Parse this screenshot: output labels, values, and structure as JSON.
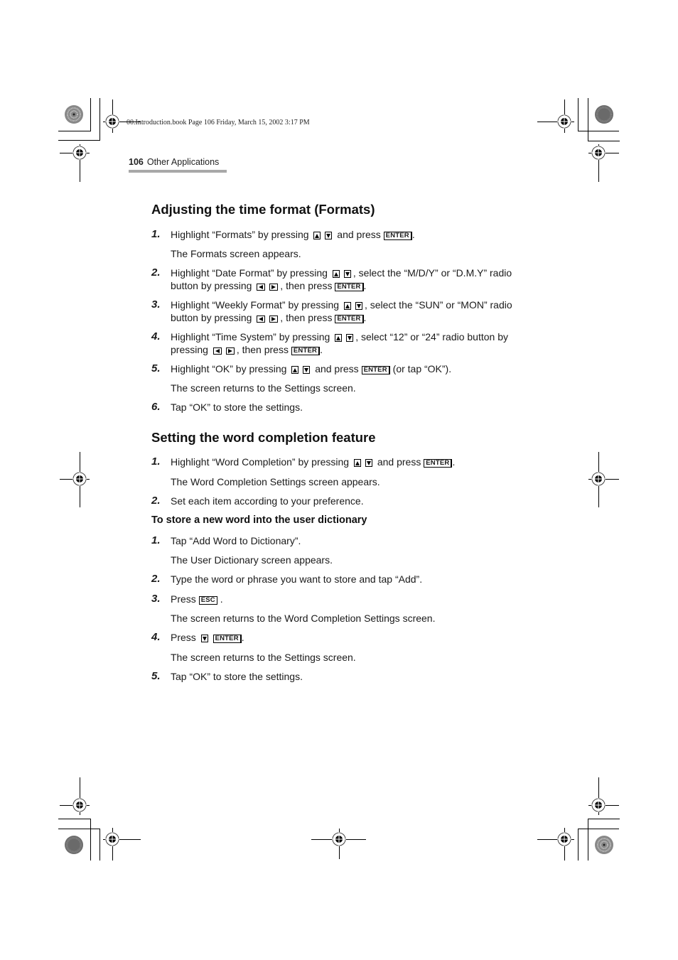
{
  "slug": "00.Introduction.book  Page 106  Friday, March 15, 2002  3:17 PM",
  "running_head": {
    "page_number": "106",
    "section": "Other Applications"
  },
  "sections": [
    {
      "title": "Adjusting the time format (Formats)",
      "steps": [
        {
          "n": "1.",
          "parts": [
            "Highlight “Formats” by pressing",
            "and press",
            "."
          ],
          "note": "The Formats screen appears."
        },
        {
          "n": "2.",
          "parts": [
            "Highlight “Date Format” by pressing",
            ", select the “M/D/Y” or “D.M.Y” radio button by pressing",
            ", then press",
            "."
          ]
        },
        {
          "n": "3.",
          "parts": [
            "Highlight “Weekly Format” by pressing",
            ", select the “SUN” or “MON” radio button by pressing",
            ", then press",
            "."
          ]
        },
        {
          "n": "4.",
          "parts": [
            "Highlight “Time System” by pressing",
            ", select “12” or “24” radio button by pressing",
            ", then press",
            "."
          ]
        },
        {
          "n": "5.",
          "parts": [
            "Highlight “OK” by pressing",
            "and press",
            "(or tap “OK”)."
          ],
          "note": "The screen returns to the Settings screen."
        },
        {
          "n": "6.",
          "parts": [
            "Tap “OK” to store the settings."
          ]
        }
      ]
    },
    {
      "title": "Setting the word completion feature",
      "steps": [
        {
          "n": "1.",
          "parts": [
            "Highlight “Word Completion” by pressing",
            "and press",
            "."
          ],
          "note": "The Word Completion Settings screen appears."
        },
        {
          "n": "2.",
          "parts": [
            "Set each item according to your preference."
          ]
        }
      ],
      "subsection": {
        "title": "To store a new word into the user dictionary",
        "steps": [
          {
            "n": "1.",
            "parts": [
              "Tap “Add Word to Dictionary”."
            ],
            "note": "The User Dictionary screen appears."
          },
          {
            "n": "2.",
            "parts": [
              "Type the word or phrase you want to store and tap “Add”."
            ]
          },
          {
            "n": "3.",
            "parts": [
              "Press",
              "."
            ],
            "note": "The screen returns to the Word Completion Settings screen."
          },
          {
            "n": "4.",
            "parts": [
              "Press",
              "."
            ],
            "note": "The screen returns to the Settings screen."
          },
          {
            "n": "5.",
            "parts": [
              "Tap “OK” to store the settings."
            ]
          }
        ]
      }
    }
  ],
  "keys": {
    "enter": "ENTER",
    "esc": "ESC"
  },
  "icons": {
    "up": "up-arrow-key",
    "down": "down-arrow-key",
    "left": "left-arrow-key",
    "right": "right-arrow-key",
    "registration": "registration-mark",
    "rosette": "color-rosette"
  }
}
